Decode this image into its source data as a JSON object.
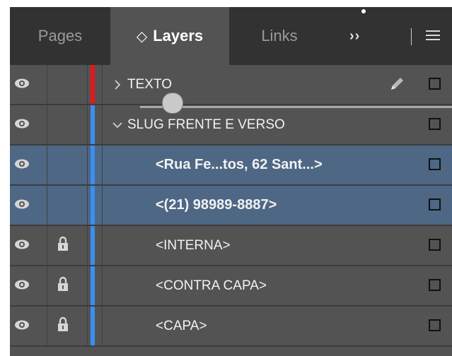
{
  "tabs": [
    {
      "label": "Pages",
      "active": false
    },
    {
      "label": "Layers",
      "active": true,
      "prefix": "◇"
    },
    {
      "label": "Links",
      "active": false
    }
  ],
  "more_label": "››",
  "layers": [
    {
      "name": "TEXTO",
      "expand": "collapsed",
      "indent": 0,
      "color": "#e8161c",
      "visible": true,
      "locked": false,
      "selected": false,
      "bold": false,
      "pen": true
    },
    {
      "name": "SLUG FRENTE E VERSO",
      "expand": "expanded",
      "indent": 0,
      "color": "#3a8ff0",
      "visible": true,
      "locked": false,
      "selected": false,
      "bold": false,
      "pen": false
    },
    {
      "name": "<Rua Fe...tos, 62 Sant...>",
      "indent": 1,
      "color": "#3a8ff0",
      "visible": true,
      "locked": false,
      "selected": true,
      "bold": true,
      "pen": false
    },
    {
      "name": "<(21) 98989-8887>",
      "indent": 1,
      "color": "#3a8ff0",
      "visible": true,
      "locked": false,
      "selected": true,
      "bold": true,
      "pen": false
    },
    {
      "name": "<INTERNA>",
      "indent": 1,
      "color": "#3a8ff0",
      "visible": true,
      "locked": true,
      "selected": false,
      "bold": false,
      "pen": false
    },
    {
      "name": "<CONTRA CAPA>",
      "indent": 1,
      "color": "#3a8ff0",
      "visible": true,
      "locked": true,
      "selected": false,
      "bold": false,
      "pen": false
    },
    {
      "name": "<CAPA>",
      "indent": 1,
      "color": "#3a8ff0",
      "visible": true,
      "locked": true,
      "selected": false,
      "bold": false,
      "pen": false
    }
  ],
  "icons": {
    "visibility": "eye-icon",
    "lock": "lock-icon",
    "edit": "pencil-icon",
    "menu": "hamburger-menu-icon"
  }
}
